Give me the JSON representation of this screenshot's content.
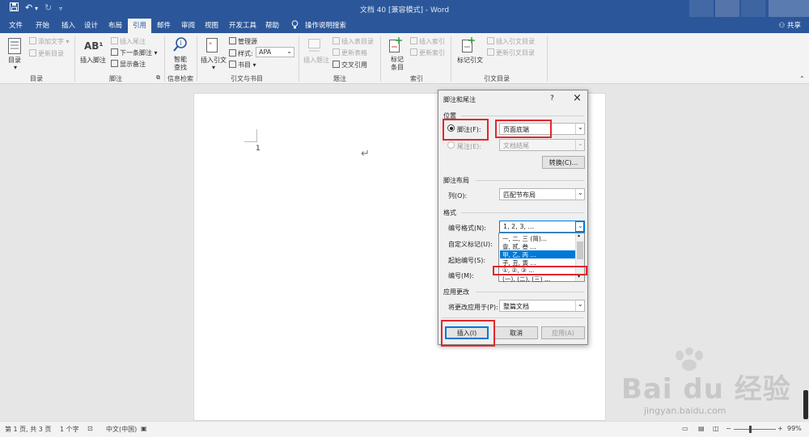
{
  "window": {
    "title": "文档 40 [兼容模式] - Word"
  },
  "tabs": {
    "items": [
      "文件",
      "开始",
      "插入",
      "设计",
      "布局",
      "引用",
      "邮件",
      "审阅",
      "视图",
      "开发工具",
      "帮助"
    ],
    "active": "引用",
    "tell_me": "操作说明搜索",
    "share": "共享"
  },
  "ribbon": {
    "toc": {
      "big": "目录",
      "add_text": "添加文字",
      "update": "更新目录",
      "group": "目录"
    },
    "footnotes": {
      "insert_footnote_icon": "AB¹",
      "insert_footnote": "插入脚注",
      "insert_endnote": "插入尾注",
      "next_footnote": "下一条脚注",
      "show_notes": "显示备注",
      "group": "脚注"
    },
    "research": {
      "smart_lookup_1": "智能",
      "smart_lookup_2": "查找",
      "group": "信息检索"
    },
    "citations": {
      "insert_citation": "插入引文",
      "manage_sources": "管理源",
      "style_label": "样式:",
      "style_value": "APA",
      "bibliography": "书目",
      "group": "引文与书目"
    },
    "captions": {
      "insert_caption": "插入题注",
      "insert_table_of_figures": "插入表目录",
      "update_table": "更新表格",
      "cross_reference": "交叉引用",
      "group": "题注"
    },
    "index": {
      "mark_entry_1": "标记",
      "mark_entry_2": "条目",
      "insert_index": "插入索引",
      "update_index": "更新索引",
      "group": "索引"
    },
    "toa": {
      "mark_citation": "标记引文",
      "insert_toa": "插入引文目录",
      "update_toa": "更新引文目录",
      "group": "引文目录"
    }
  },
  "document": {
    "footnote_number": "1",
    "return_mark": "↵"
  },
  "dialog": {
    "title": "脚注和尾注",
    "help": "?",
    "close": "×",
    "location_header": "位置",
    "footnote_label": "脚注(F):",
    "footnote_value": "页面底端",
    "endnote_label": "尾注(E):",
    "endnote_value": "文档结尾",
    "convert_button": "转换(C)...",
    "layout_header": "脚注布局",
    "columns_label": "列(O):",
    "columns_value": "匹配节布局",
    "format_header": "格式",
    "number_format_label": "编号格式(N):",
    "number_format_value": "1, 2, 3, ...",
    "custom_mark_label": "自定义标记(U):",
    "start_at_label": "起始编号(S):",
    "numbering_label": "编号(M):",
    "number_format_options": [
      "一, 二, 三 (简)...",
      "壹, 贰, 叁 ...",
      "甲, 乙, 丙 ...",
      "子, 丑, 寅 ...",
      "①, ②, ③ ...",
      "(一), (二), (三) ..."
    ],
    "selected_option_index": 2,
    "apply_header": "应用更改",
    "apply_to_label": "将更改应用于(P):",
    "apply_to_value": "整篇文档",
    "insert_button": "插入(I)",
    "cancel_button": "取消",
    "apply_button": "应用(A)"
  },
  "statusbar": {
    "page": "第 1 页, 共 3 页",
    "words": "1 个字",
    "language": "中文(中国)",
    "zoom": "99%"
  },
  "watermark": {
    "brand": "Bai du 经验",
    "url": "jingyan.baidu.com"
  },
  "colors": {
    "word_blue": "#2b579a",
    "highlight_red": "#e0282e",
    "selection_blue": "#0078d7"
  }
}
